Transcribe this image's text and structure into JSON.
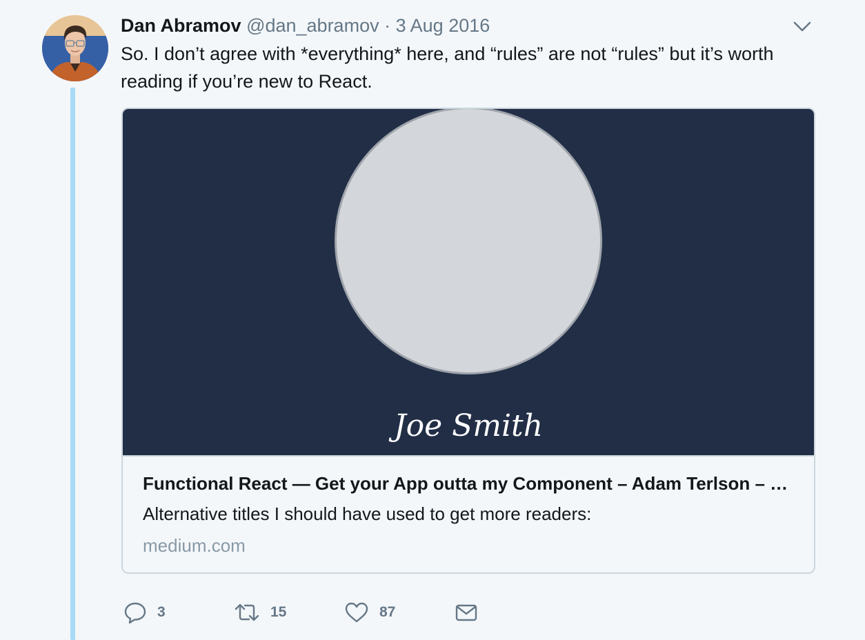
{
  "tweet": {
    "author_name": "Dan Abramov",
    "author_handle": "@dan_abramov",
    "separator": "·",
    "date": "3 Aug 2016",
    "text": "So. I don’t agree with *everything* here, and “rules” are not “rules” but it’s worth reading if you’re new to React.",
    "avatar_icon": "profile-photo",
    "caret_icon": "chevron-down-icon"
  },
  "card": {
    "image_name": "Joe Smith",
    "title": "Functional React — Get your App outta my Component – Adam Terlson – Medium",
    "description": "Alternative titles I should have used to get more readers:",
    "domain": "medium.com"
  },
  "actions": {
    "reply": {
      "icon": "reply-icon",
      "count": "3"
    },
    "retweet": {
      "icon": "retweet-icon",
      "count": "15"
    },
    "like": {
      "icon": "heart-icon",
      "count": "87"
    },
    "message": {
      "icon": "envelope-icon"
    }
  },
  "colors": {
    "background": "#f4f7fa",
    "thread_line": "#a8daf7",
    "secondary_text": "#657786",
    "card_image_bg": "#212e46"
  }
}
